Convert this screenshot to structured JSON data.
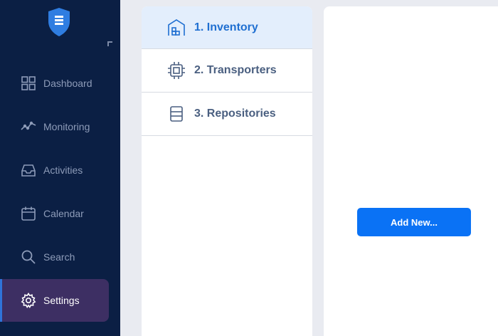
{
  "sidebar": {
    "items": [
      {
        "label": "Dashboard",
        "icon": "grid-icon"
      },
      {
        "label": "Monitoring",
        "icon": "activity-line-icon"
      },
      {
        "label": "Activities",
        "icon": "inbox-icon"
      },
      {
        "label": "Calendar",
        "icon": "calendar-icon"
      },
      {
        "label": "Search",
        "icon": "search-icon"
      },
      {
        "label": "Settings",
        "icon": "gear-icon",
        "active": true
      }
    ]
  },
  "steps": [
    {
      "label": "1. Inventory",
      "icon": "warehouse-icon",
      "active": true
    },
    {
      "label": "2. Transporters",
      "icon": "chip-icon"
    },
    {
      "label": "3. Repositories",
      "icon": "storage-icon"
    }
  ],
  "content": {
    "add_button_label": "Add New..."
  },
  "colors": {
    "sidebar_bg": "#0b1f44",
    "active_nav_bg": "#3d2f63",
    "accent": "#0a72f5",
    "active_step_bg": "#e3eefc"
  }
}
